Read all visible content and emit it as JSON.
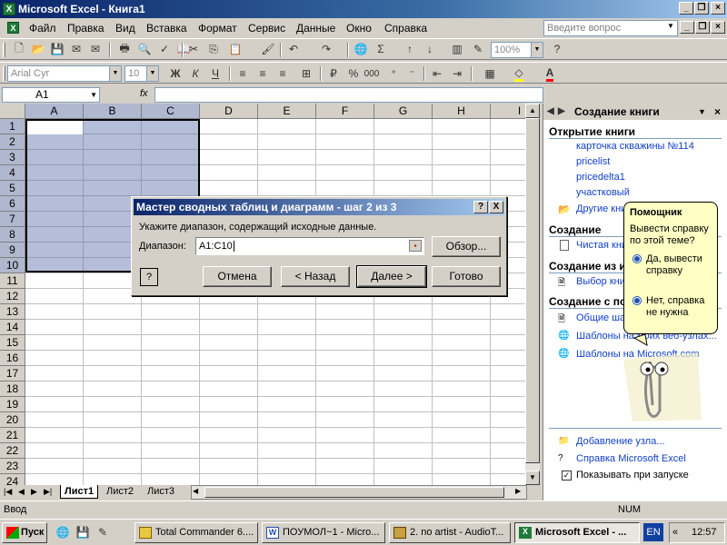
{
  "window": {
    "title": "Microsoft Excel - Книга1"
  },
  "menu": [
    "Файл",
    "Правка",
    "Вид",
    "Вставка",
    "Формат",
    "Сервис",
    "Данные",
    "Окно",
    "Справка"
  ],
  "ask_placeholder": "Введите вопрос",
  "toolbar": {
    "zoom": "100%",
    "font": "Arial Cyr",
    "size": "10",
    "bold": "Ж",
    "italic": "К",
    "underline": "Ч",
    "percent": "%",
    "thousands": "000"
  },
  "formula": {
    "name_box": "A1",
    "fx": "fx"
  },
  "columns": [
    "A",
    "B",
    "C",
    "D",
    "E",
    "F",
    "G",
    "H",
    "I"
  ],
  "rows": [
    "1",
    "2",
    "3",
    "4",
    "5",
    "6",
    "7",
    "8",
    "9",
    "10",
    "11",
    "12",
    "13",
    "14",
    "15",
    "16",
    "17",
    "18",
    "19",
    "20",
    "21",
    "22",
    "23",
    "24"
  ],
  "sheets": [
    "Лист1",
    "Лист2",
    "Лист3"
  ],
  "dialog": {
    "title": "Мастер сводных таблиц и диаграмм - шаг 2 из 3",
    "help_btn": "?",
    "close_btn": "X",
    "prompt": "Укажите диапазон, содержащий исходные данные.",
    "range_label": "Диапазон:",
    "range_value": "A1:C10",
    "browse": "Обзор...",
    "help_icon": "?",
    "cancel": "Отмена",
    "back": "< Назад",
    "next": "Далее >",
    "finish": "Готово"
  },
  "taskpane": {
    "title": "Создание книги",
    "open_section": "Открытие книги",
    "recent": [
      "карточка скважины №114",
      "pricelist",
      "pricedelta1",
      "участковый"
    ],
    "other_books": "Другие книги...",
    "create_section": "Создание",
    "blank_book": "Чистая книга",
    "from_existing_section": "Создание из имеющейся книги",
    "choose_book": "Выбор книги...",
    "from_template_section": "Создание с помощью шаблона",
    "templates": [
      "Общие шаблоны...",
      "Шаблоны на моих веб-узлах...",
      "Шаблоны на Microsoft.com"
    ],
    "add_node": "Добавление узла...",
    "excel_help": "Справка Microsoft Excel",
    "show_at_startup": "Показывать при запуске"
  },
  "assistant": {
    "title": "Помощник",
    "question": "Вывести справку по этой теме?",
    "option_yes": "Да, вывести справку",
    "option_no": "Нет, справка не нужна"
  },
  "status": {
    "left": "Ввод",
    "num": "NUM"
  },
  "taskbar": {
    "start": "Пуск",
    "buttons": [
      "Total Commander 6....",
      "ПОУМОЛ~1 - Micro...",
      "2. no artist - AudioT...",
      "Microsoft Excel - ..."
    ],
    "lang": "EN",
    "time": "12:57"
  },
  "colors": {
    "title_start": "#0a246a",
    "title_end": "#a6caf0",
    "selection": "#5c6eaa",
    "link": "#1140c8",
    "excel_green": "#1f7a3a"
  }
}
